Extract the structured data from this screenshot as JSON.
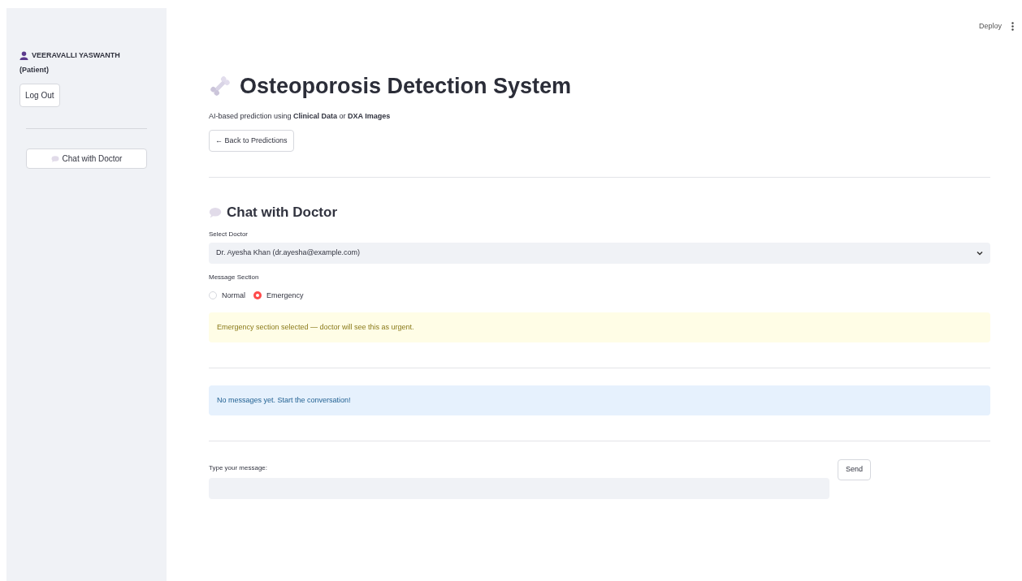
{
  "header": {
    "deploy": "Deploy"
  },
  "sidebar": {
    "user_name": "VEERAVALLI YASWANTH",
    "role": "(Patient)",
    "logout": "Log Out",
    "nav_button": "Chat with Doctor"
  },
  "title": "Osteoporosis Detection System",
  "subtitle": "AI-based prediction using **Clinical Data** or **DXA Images**",
  "back_button": "← Back to Predictions",
  "chat": {
    "heading": "Chat with Doctor",
    "doctor_label": "Select Doctor",
    "doctor_value": "Dr. Ayesha Khan (dr.ayesha@example.com)",
    "section_label": "Message Section",
    "sections": [
      {
        "label": "Normal",
        "selected": false
      },
      {
        "label": "Emergency",
        "selected": true
      }
    ],
    "alerts": [
      {
        "kind": "warning",
        "text": "Emergency section selected — doctor will see this as urgent."
      },
      {
        "kind": "info",
        "text": "No messages yet. Start the conversation!"
      }
    ],
    "message_label": "Type your message:",
    "send": "Send"
  }
}
